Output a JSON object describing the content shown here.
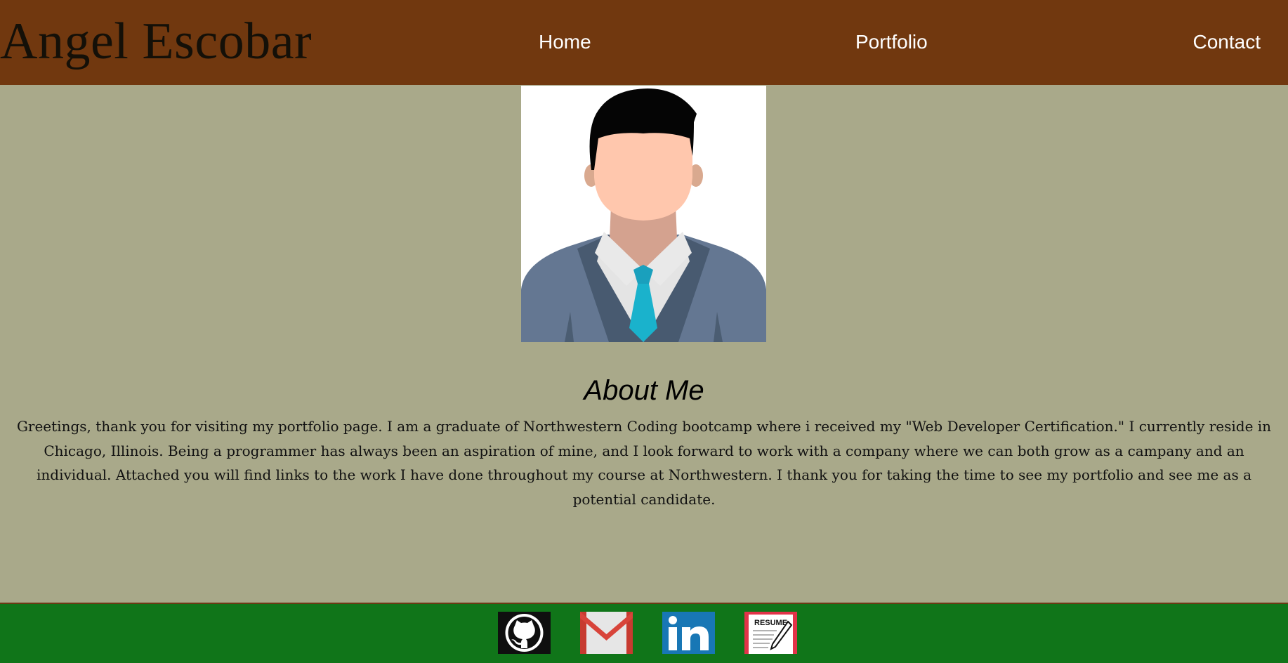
{
  "header": {
    "brand": "Angel Escobar",
    "nav": {
      "home": "Home",
      "portfolio": "Portfolio",
      "contact": "Contact"
    },
    "background_color": "#71380f"
  },
  "main": {
    "background_color": "#a9a98a",
    "portrait_icon": "businessman-avatar-icon",
    "about": {
      "heading": "About Me",
      "body": "Greetings, thank you for visiting my portfolio page. I am a graduate of Northwestern Coding bootcamp where i received my \"Web Developer Certification.\" I currently reside in Chicago, Illinois. Being a programmer has always been an aspiration of mine, and I look forward to work with a company where we can both grow as a campany and an individual. Attached you will find links to the work I have done throughout my course at Northwestern. I thank you for taking the time to see my portfolio and see me as a potential candidate."
    }
  },
  "footer": {
    "background_color": "#107519",
    "links": [
      {
        "icon": "github-icon"
      },
      {
        "icon": "gmail-icon"
      },
      {
        "icon": "linkedin-icon"
      },
      {
        "icon": "resume-icon",
        "label": "RESUME"
      }
    ]
  }
}
